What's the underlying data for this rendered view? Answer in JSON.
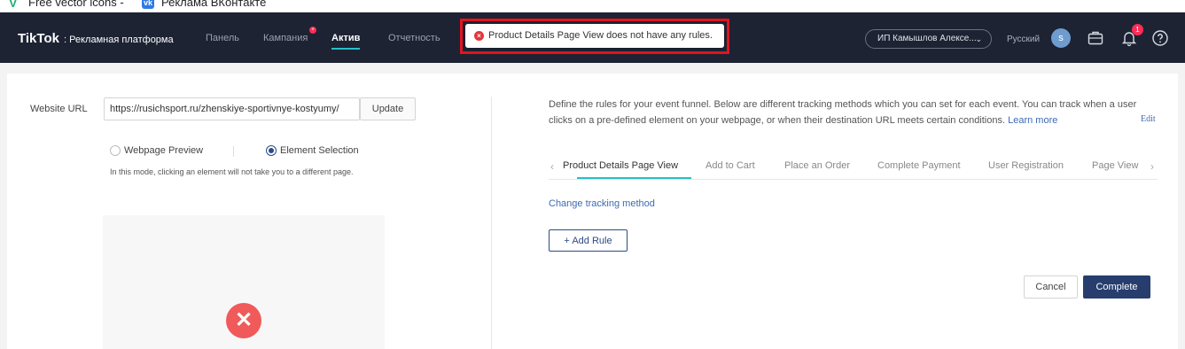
{
  "bookmarks": [
    {
      "label": "Free vector icons -",
      "icon": "vector-icon"
    },
    {
      "label": "Реклама ВКонтакте",
      "icon": "vk-icon"
    }
  ],
  "nav": {
    "logo": "TikTok",
    "logo_sub": "Рекламная платформа",
    "items": [
      "Панель",
      "Кампания",
      "Актив",
      "Отчетность"
    ],
    "active": "Актив",
    "account": "ИП Камышлов Алексе...",
    "language": "Русский",
    "avatar_letter": "s",
    "notification_count": "1"
  },
  "toast": {
    "message": "Product Details Page View does not have any rules.",
    "color": "#e5363b"
  },
  "left": {
    "url_label": "Website URL",
    "url_value": "https://rusichsport.ru/zhenskiye-sportivnye-kostyumy/",
    "update_label": "Update",
    "radio_preview": "Webpage Preview",
    "radio_selection": "Element Selection",
    "hint": "In this mode, clicking an element will not take you to a different page.",
    "error_symbol": "✕"
  },
  "right": {
    "description": "Define the rules for your event funnel. Below are different tracking methods which you can set for each event. You can track when a user clicks on a pre-defined element on your webpage, or when their destination URL meets certain conditions.",
    "learn_more": "Learn more",
    "edit": "Edit",
    "tabs": [
      "Product Details Page View",
      "Add to Cart",
      "Place an Order",
      "Complete Payment",
      "User Registration",
      "Page View"
    ],
    "change_tracking": "Change tracking method",
    "add_rule": "Add Rule",
    "cancel": "Cancel",
    "complete": "Complete"
  },
  "colors": {
    "nav_bg": "#1d2333",
    "accent": "#27c0c4",
    "primary": "#263d6e",
    "link": "#3d6bb3",
    "highlight_box": "#e2141e"
  }
}
